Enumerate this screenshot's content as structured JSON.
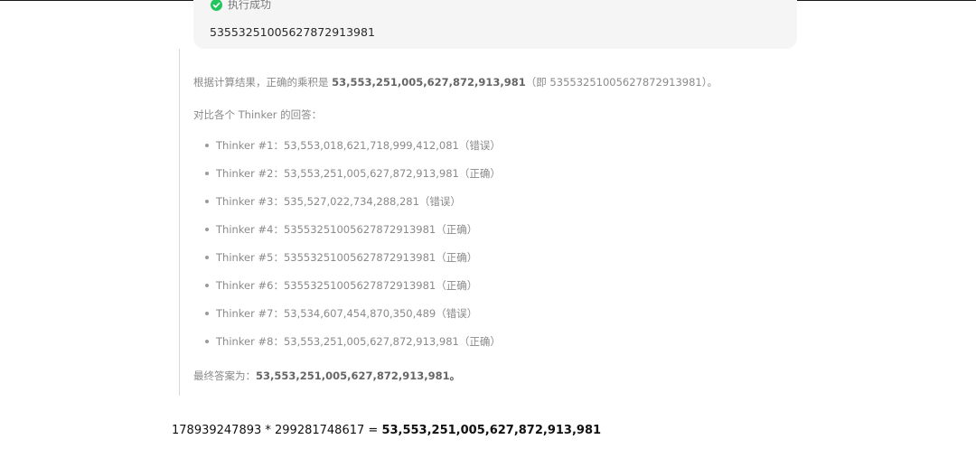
{
  "exec": {
    "status": "执行成功",
    "output": "53553251005627872913981"
  },
  "thinking": {
    "result_prefix": "根据计算结果，正确的乘积是 ",
    "result_bold": "53,553,251,005,627,872,913,981",
    "result_suffix": "（即 53553251005627872913981）。",
    "compare_intro": "对比各个 Thinker 的回答：",
    "thinkers": [
      {
        "label": "Thinker #1：53,553,018,621,718,999,412,081（错误）"
      },
      {
        "label": "Thinker #2：53,553,251,005,627,872,913,981（正确）"
      },
      {
        "label": "Thinker #3：535,527,022,734,288,281（错误）"
      },
      {
        "label": "Thinker #4：53553251005627872913981（正确）"
      },
      {
        "label": "Thinker #5：53553251005627872913981（正确）"
      },
      {
        "label": "Thinker #6：53553251005627872913981（正确）"
      },
      {
        "label": "Thinker #7：53,534,607,454,870,350,489（错误）"
      },
      {
        "label": "Thinker #8：53,553,251,005,627,872,913,981（正确）"
      }
    ],
    "final_prefix": "最终答案为：",
    "final_bold": "53,553,251,005,627,872,913,981。"
  },
  "answer": {
    "equation": "178939247893 * 299281748617 = ",
    "result": "53,553,251,005,627,872,913,981"
  },
  "colors": {
    "success": "#22c55e",
    "panel_bg": "#f5f5f5"
  },
  "icons": {
    "status": "check-circle-icon"
  }
}
